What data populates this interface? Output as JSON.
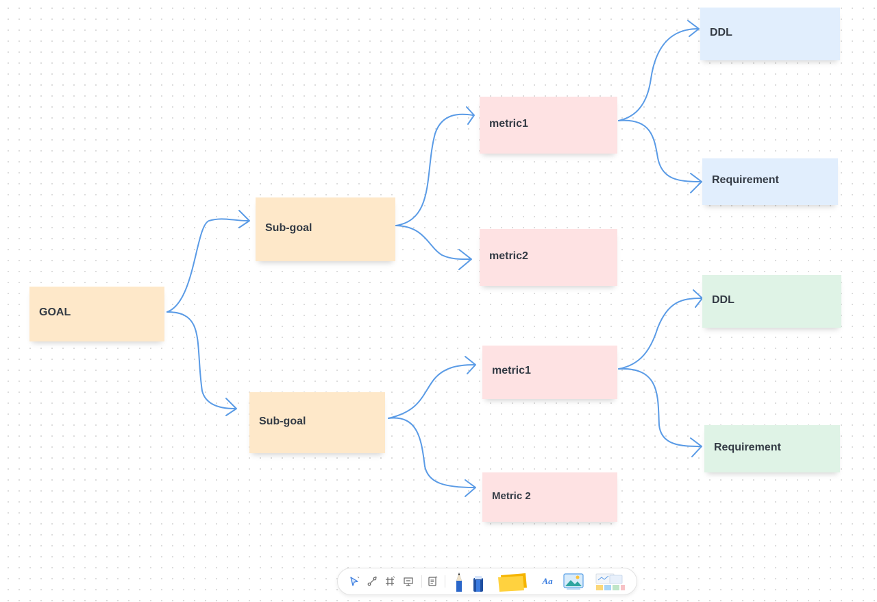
{
  "notes": {
    "goal": {
      "label": "GOAL",
      "color": "#fee8c9"
    },
    "subgoal_top": {
      "label": "Sub-goal",
      "color": "#fee8c9"
    },
    "subgoal_bottom": {
      "label": "Sub-goal",
      "color": "#fee8c9"
    },
    "metric1_top": {
      "label": "metric1",
      "color": "#fee2e3"
    },
    "metric2_top": {
      "label": "metric2",
      "color": "#fee2e3"
    },
    "metric1_bottom": {
      "label": "metric1",
      "color": "#fee2e3"
    },
    "metric2_bottom": {
      "label": "Metric 2",
      "color": "#fee2e3"
    },
    "ddl_top": {
      "label": "DDL",
      "color": "#e1eefd"
    },
    "requirement_top": {
      "label": "Requirement",
      "color": "#e1eefd"
    },
    "ddl_bottom": {
      "label": "DDL",
      "color": "#dff3e6"
    },
    "requirement_bottom": {
      "label": "Requirement",
      "color": "#dff3e6"
    }
  },
  "connector_color": "#5a9be6",
  "toolbar": {
    "tools": [
      {
        "id": "select",
        "icon": "cursor-icon"
      },
      {
        "id": "connector",
        "icon": "connector-icon"
      },
      {
        "id": "frame",
        "icon": "frame-icon"
      },
      {
        "id": "presentation",
        "icon": "presentation-icon"
      },
      {
        "id": "template",
        "icon": "template-icon"
      },
      {
        "id": "pen",
        "icon": "pen-icon"
      },
      {
        "id": "highlighter",
        "icon": "highlighter-icon"
      },
      {
        "id": "sticky-note",
        "icon": "sticky-note-icon"
      },
      {
        "id": "text",
        "icon": "text-icon",
        "label": "Aa"
      },
      {
        "id": "image",
        "icon": "image-icon"
      },
      {
        "id": "more-templates",
        "icon": "templates-gallery-icon"
      }
    ]
  }
}
